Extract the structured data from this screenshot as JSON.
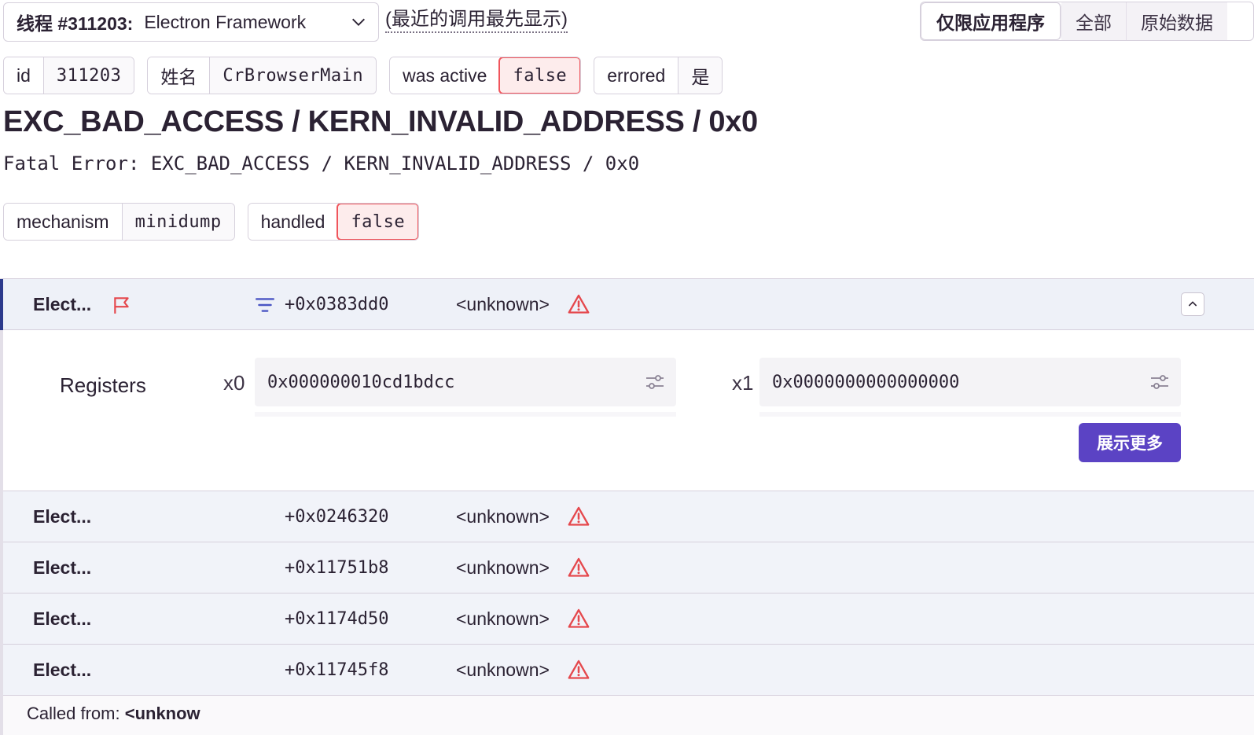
{
  "thread": {
    "label": "线程 #311203:",
    "value": "Electron Framework",
    "order_note": "(最近的调用最先显示)"
  },
  "view_toggle": [
    "仅限应用程序",
    "全部",
    "原始数据"
  ],
  "tags_row1": [
    {
      "key": "id",
      "value": "311203",
      "error": false
    },
    {
      "key": "姓名",
      "value": "CrBrowserMain",
      "error": false
    },
    {
      "key": "was active",
      "value": "false",
      "error": true
    },
    {
      "key": "errored",
      "value": "是",
      "error": false
    }
  ],
  "exception": {
    "title": "EXC_BAD_ACCESS / KERN_INVALID_ADDRESS / 0x0",
    "subtitle": "Fatal Error: EXC_BAD_ACCESS / KERN_INVALID_ADDRESS / 0x0"
  },
  "tags_row2": [
    {
      "key": "mechanism",
      "value": "minidump",
      "error": false
    },
    {
      "key": "handled",
      "value": "false",
      "error": true
    }
  ],
  "frames": [
    {
      "fn": "Elect...",
      "addr": "+0x0383dd0",
      "symbol": "<unknown>"
    },
    {
      "fn": "Elect...",
      "addr": "+0x0246320",
      "symbol": "<unknown>"
    },
    {
      "fn": "Elect...",
      "addr": "+0x11751b8",
      "symbol": "<unknown>"
    },
    {
      "fn": "Elect...",
      "addr": "+0x1174d50",
      "symbol": "<unknown>"
    },
    {
      "fn": "Elect...",
      "addr": "+0x11745f8",
      "symbol": "<unknown>"
    }
  ],
  "registers": {
    "label": "Registers",
    "x0_name": "x0",
    "x0_value": "0x000000010cd1bdcc",
    "x1_name": "x1",
    "x1_value": "0x0000000000000000",
    "show_more": "展示更多"
  },
  "called_from": {
    "label": "Called from: ",
    "value": "<unknow"
  },
  "colors": {
    "accent": "#5b43c4",
    "error": "#f0555c",
    "active_bar": "#2c3a8c"
  }
}
